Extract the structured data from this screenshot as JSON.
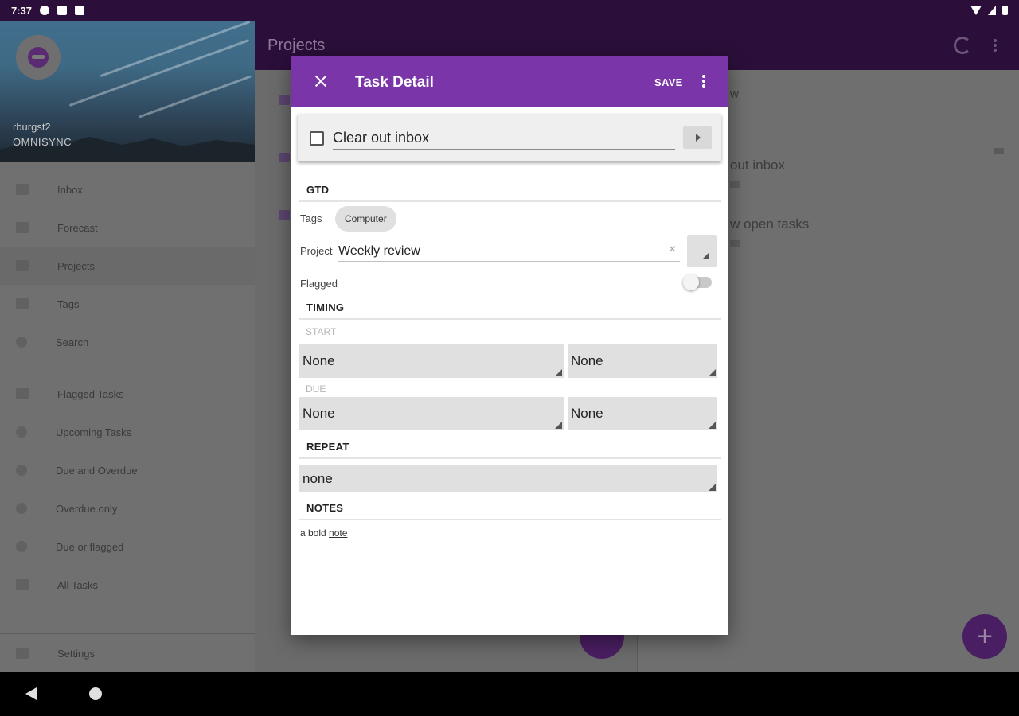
{
  "status_bar": {
    "time": "7:37"
  },
  "drawer": {
    "account_name": "rburgst2",
    "account_sync": "OMNISYNC",
    "items": [
      {
        "label": "Inbox"
      },
      {
        "label": "Forecast"
      },
      {
        "label": "Projects"
      },
      {
        "label": "Tags"
      },
      {
        "label": "Search"
      }
    ],
    "perspectives": [
      {
        "label": "Flagged Tasks"
      },
      {
        "label": "Upcoming Tasks"
      },
      {
        "label": "Due and Overdue"
      },
      {
        "label": "Overdue only"
      },
      {
        "label": "Due or flagged"
      },
      {
        "label": "All Tasks"
      }
    ],
    "settings_label": "Settings"
  },
  "appbar": {
    "title": "Projects"
  },
  "background": {
    "detail_header_fragment": "w",
    "task_fragment_1": "out inbox",
    "task_fragment_2": "w open tasks"
  },
  "dialog": {
    "title": "Task Detail",
    "save_label": "SAVE",
    "task_name": "Clear out inbox",
    "sections": {
      "gtd": "GTD",
      "timing": "TIMING",
      "repeat": "REPEAT",
      "notes": "NOTES"
    },
    "tags_label": "Tags",
    "tag_chip": "Computer",
    "project_label": "Project",
    "project_value": "Weekly review",
    "project_clear": "×",
    "flagged_label": "Flagged",
    "flagged": false,
    "start_label": "START",
    "start_date": "None",
    "start_time": "None",
    "due_label": "DUE",
    "due_date": "None",
    "due_time": "None",
    "repeat_value": "none",
    "notes_text_plain": "a bold ",
    "notes_text_underlined": "note "
  },
  "fab_plus": "+"
}
